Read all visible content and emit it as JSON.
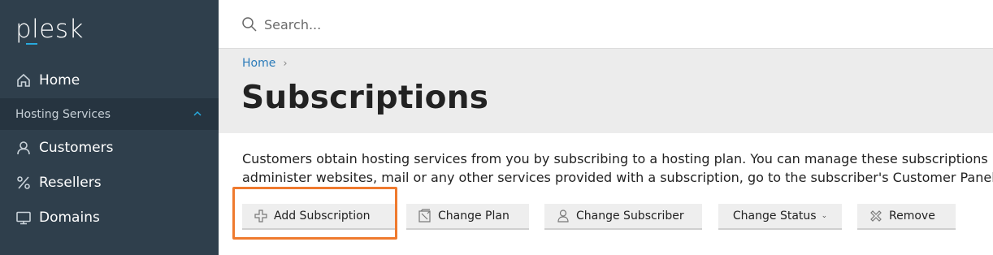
{
  "app": {
    "logo_text": "plesk",
    "accent": "#28aade"
  },
  "sidebar": {
    "home_label": "Home",
    "section_label": "Hosting Services",
    "items": [
      {
        "label": "Customers",
        "icon": "user-icon"
      },
      {
        "label": "Resellers",
        "icon": "percent-icon"
      },
      {
        "label": "Domains",
        "icon": "monitor-icon"
      }
    ]
  },
  "search": {
    "placeholder": "Search..."
  },
  "breadcrumb": {
    "home": "Home",
    "separator": "›"
  },
  "page": {
    "title": "Subscriptions",
    "description_line1": "Customers obtain hosting services from you by subscribing to a hosting plan. You can manage these subscriptions her",
    "description_line2": "administer websites, mail or any other services provided with a subscription, go to the subscriber's Customer Panel by"
  },
  "toolbar": {
    "add_subscription": "Add Subscription",
    "change_plan": "Change Plan",
    "change_subscriber": "Change Subscriber",
    "change_status": "Change Status",
    "remove": "Remove"
  },
  "highlight_color": "#ef7a2e"
}
